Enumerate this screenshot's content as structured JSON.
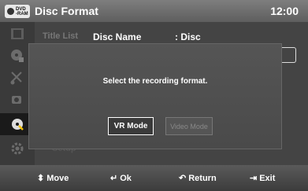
{
  "header": {
    "badge_text": "DVD\n-RAM",
    "title": "Disc Format",
    "clock": "12:00"
  },
  "sidebar": {
    "items": [
      {
        "icon": "film-icon",
        "label": "Title List"
      },
      {
        "icon": "disc-plus-icon"
      },
      {
        "icon": "scissors-icon"
      },
      {
        "icon": "copy-icon"
      },
      {
        "icon": "disc-manager-icon"
      },
      {
        "icon": "gear-icon",
        "label": "Setup"
      }
    ]
  },
  "main": {
    "tab_title": "Title List",
    "header_name_label": "Disc Name",
    "header_name_value": ": Disc",
    "setup_label": "Setup"
  },
  "dialog": {
    "message": "Select the recording format.",
    "buttons": [
      {
        "label": "VR Mode",
        "selected": true
      },
      {
        "label": "Video Mode",
        "selected": false
      }
    ]
  },
  "footer": {
    "move": "Move",
    "ok": "Ok",
    "return": "Return",
    "exit": "Exit"
  },
  "colors": {
    "background": "#444444",
    "titlebar": "#6e6e6e",
    "text": "#ffffff",
    "disabled_text": "#888888"
  }
}
